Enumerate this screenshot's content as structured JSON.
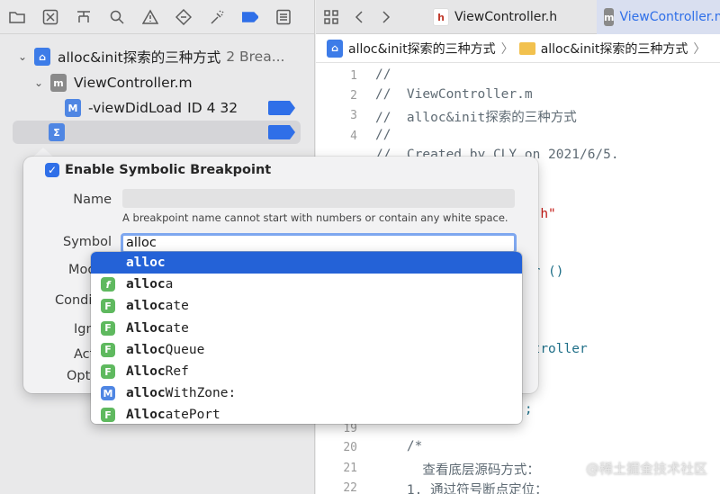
{
  "navigator": {
    "toolbar_icons": [
      "folder-icon",
      "source-control-icon",
      "hierarchy-icon",
      "search-icon",
      "warning-icon",
      "test-diamond-icon",
      "debug-spray-icon",
      "breakpoint-icon",
      "report-icon"
    ],
    "rows": [
      {
        "label": "alloc&init探索的三种方式",
        "detail": "2 Brea..."
      },
      {
        "label": "ViewController.m"
      },
      {
        "label": "-viewDidLoad",
        "detail": "ID 4  32"
      },
      {
        "label": ""
      }
    ]
  },
  "popover": {
    "enable_label": "Enable Symbolic Breakpoint",
    "name_label": "Name",
    "name_hint": "A breakpoint name cannot start with numbers or contain any white space.",
    "symbol_label": "Symbol",
    "symbol_value": "alloc",
    "module_label": "Mod",
    "condition_label": "Conditi",
    "ignore_label": "Ign",
    "action_label": "Act",
    "options_label": "Opti"
  },
  "completion": {
    "items": [
      {
        "match": "alloc",
        "rest": "",
        "badge": ""
      },
      {
        "match": "alloc",
        "rest": "a",
        "badge": "f"
      },
      {
        "match": "alloc",
        "rest": "ate",
        "badge": "F"
      },
      {
        "match": "Alloc",
        "rest": "ate",
        "badge": "F"
      },
      {
        "match": "alloc",
        "rest": "Queue",
        "badge": "F"
      },
      {
        "match": "Alloc",
        "rest": "Ref",
        "badge": "F"
      },
      {
        "match": "alloc",
        "rest": "WithZone:",
        "badge": "M"
      },
      {
        "match": "Alloc",
        "rest": "atePort",
        "badge": "F"
      }
    ]
  },
  "editor": {
    "tabs": [
      {
        "label": "ViewController.h",
        "icon": "h"
      },
      {
        "label": "ViewController.m",
        "icon": "m"
      }
    ],
    "breadcrumb": [
      "alloc&init探索的三种方式",
      "alloc&init探索的三种方式"
    ],
    "lines": [
      {
        "n": "1",
        "code": "//",
        "kind": "comment"
      },
      {
        "n": "2",
        "code": "//  ViewController.m",
        "kind": "comment"
      },
      {
        "n": "3",
        "code": "//  alloc&init探索的三种方式",
        "kind": "comment"
      },
      {
        "n": "4",
        "code": "//",
        "kind": "comment"
      },
      {
        "n": "",
        "code": "//  Created by CLY on 2021/6/5.",
        "kind": "comment"
      },
      {
        "n": "",
        "code": "",
        "kind": "plain"
      },
      {
        "n": "",
        "code": "                ller.h\"",
        "kind": "string"
      },
      {
        "n": "",
        "code": "                 \"",
        "kind": "string"
      },
      {
        "n": "",
        "code": "              troller ()",
        "kind": "mixed"
      },
      {
        "n": "",
        "code": "",
        "kind": "plain"
      },
      {
        "n": "",
        "code": "",
        "kind": "plain"
      },
      {
        "n": "",
        "code": "             ViewController",
        "kind": "type"
      },
      {
        "n": "",
        "code": "",
        "kind": "plain"
      },
      {
        "n": "",
        "code": "              d {",
        "kind": "plain"
      },
      {
        "n": "",
        "code": "             dLoad];",
        "kind": "type"
      },
      {
        "n": "19",
        "code": "",
        "kind": "plain"
      },
      {
        "n": "20",
        "code": "    /*",
        "kind": "comment"
      },
      {
        "n": "21",
        "code": "      查看底层源码方式：",
        "kind": "comment"
      },
      {
        "n": "22",
        "code": "    1. 通过符号断点定位：",
        "kind": "comment"
      }
    ],
    "watermark": "@稀土掘金技术社区"
  },
  "colors": {
    "accent": "#2f6fe8",
    "selection": "#2462d7",
    "function_badge": "#5fb95f",
    "method_badge": "#4f86e3"
  }
}
